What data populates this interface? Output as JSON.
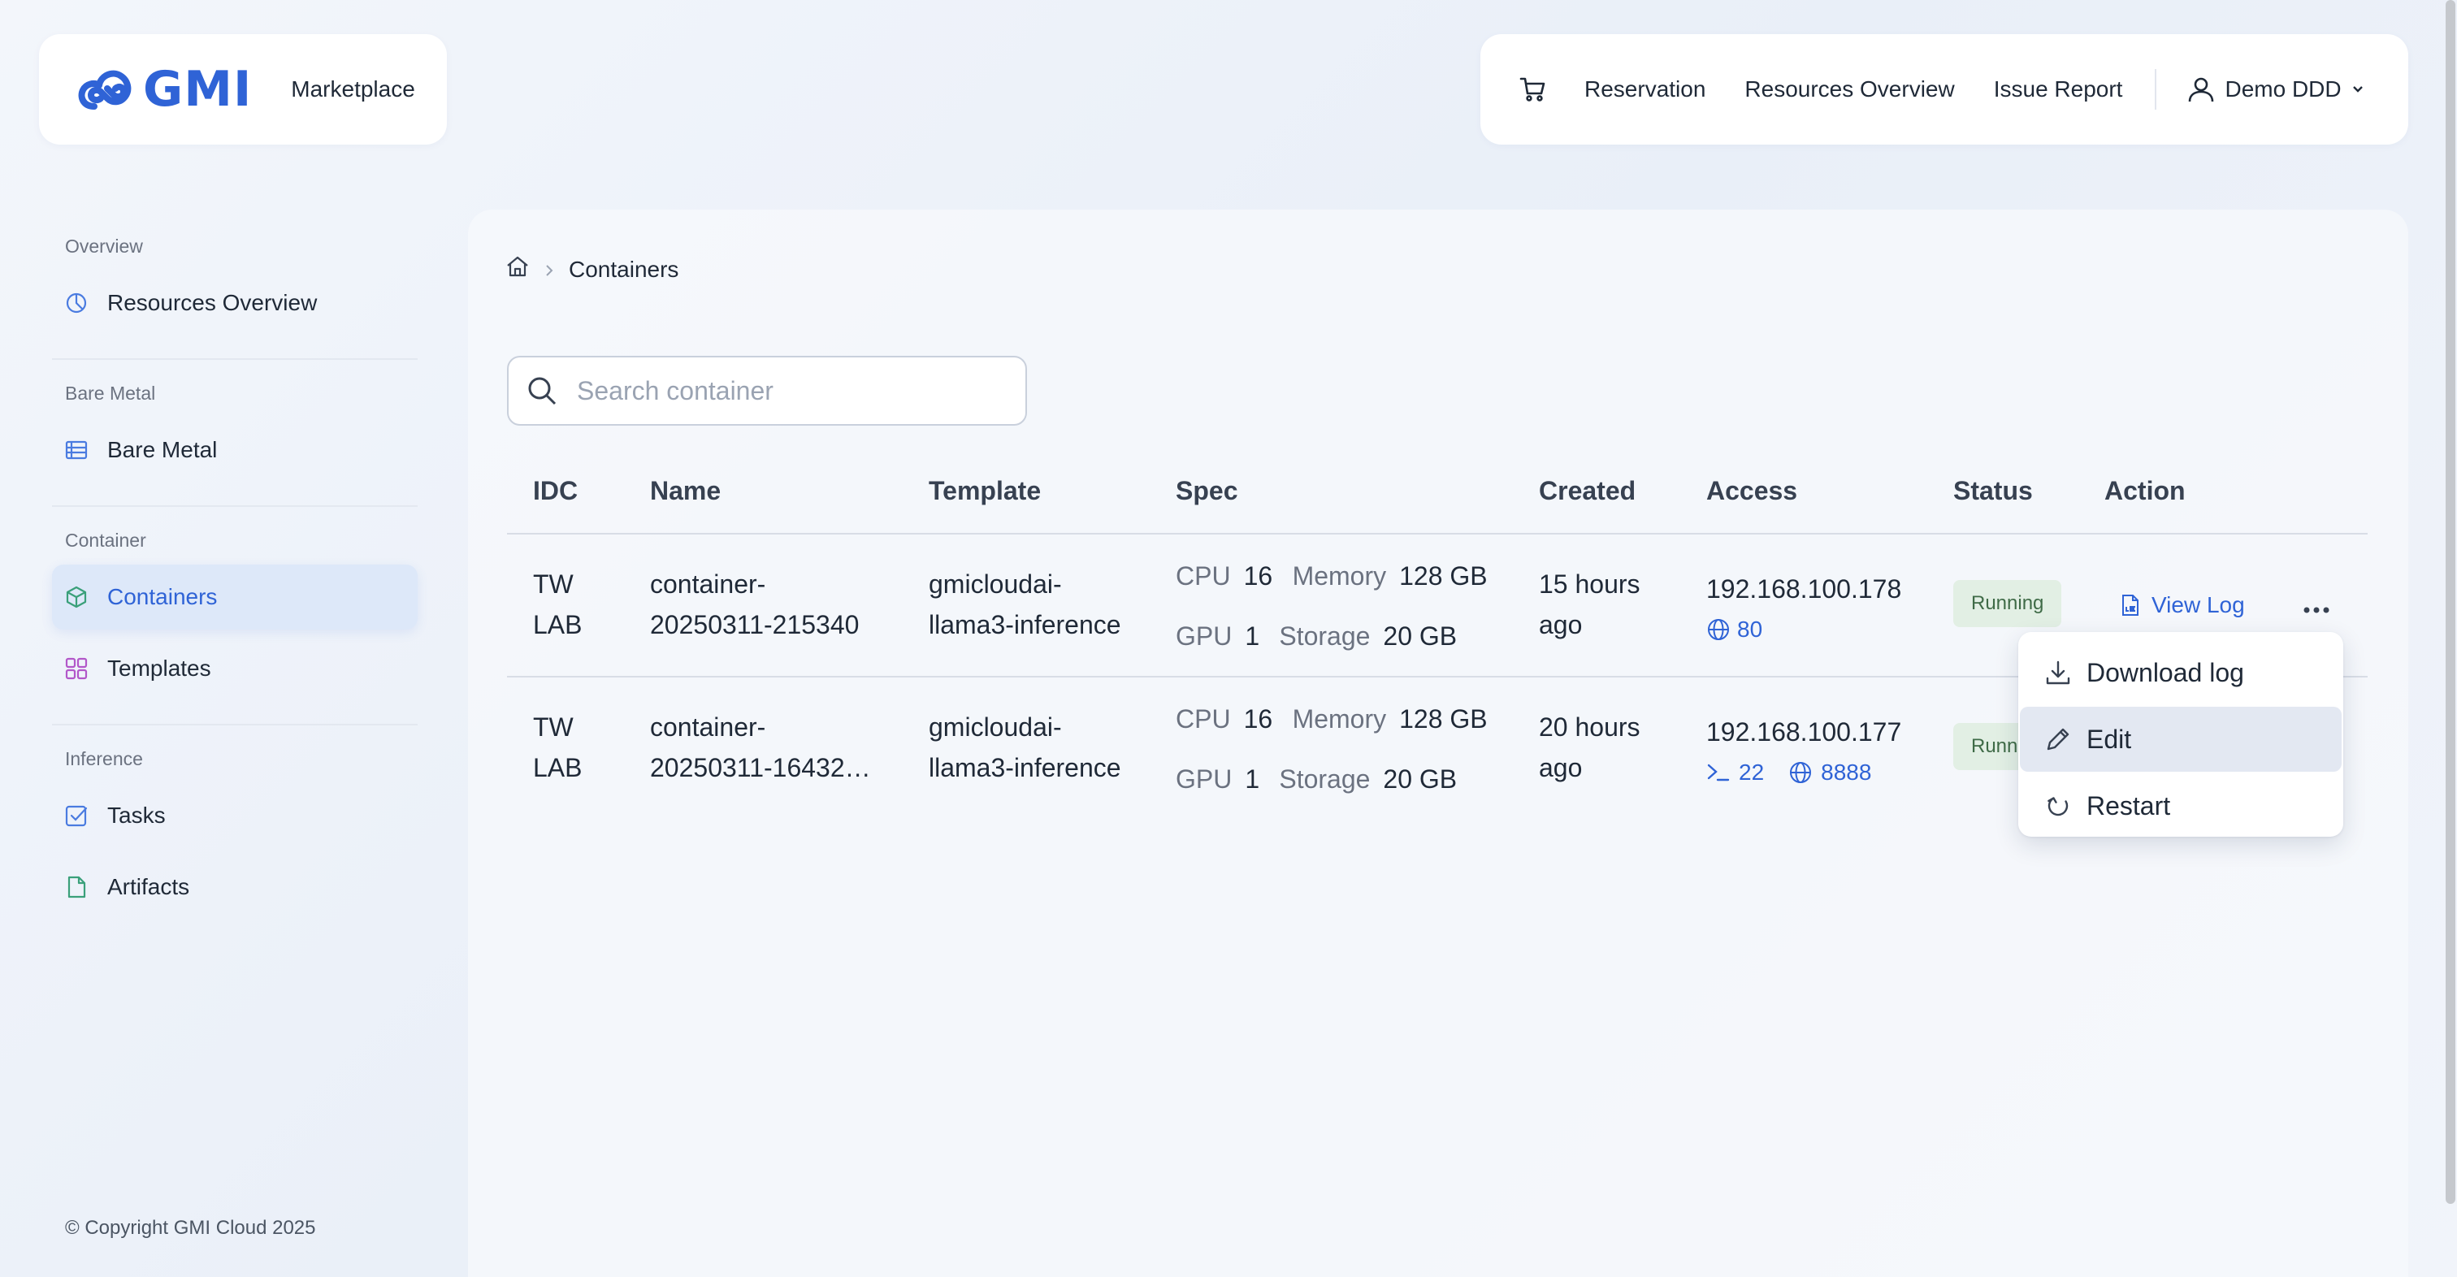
{
  "brand": {
    "logo_text": "GMI",
    "marketplace_label": "Marketplace"
  },
  "topnav": {
    "cart_icon": "cart-icon",
    "links": [
      "Reservation",
      "Resources Overview",
      "Issue Report"
    ],
    "user_name": "Demo DDD"
  },
  "sidebar": {
    "sections": [
      {
        "label": "Overview",
        "items": [
          {
            "label": "Resources Overview",
            "icon": "pie-chart-icon"
          }
        ]
      },
      {
        "label": "Bare Metal",
        "items": [
          {
            "label": "Bare Metal",
            "icon": "server-icon"
          }
        ]
      },
      {
        "label": "Container",
        "items": [
          {
            "label": "Containers",
            "icon": "cube-icon",
            "active": true
          },
          {
            "label": "Templates",
            "icon": "grid-icon"
          }
        ]
      },
      {
        "label": "Inference",
        "items": [
          {
            "label": "Tasks",
            "icon": "checkbox-icon"
          },
          {
            "label": "Artifacts",
            "icon": "file-icon"
          }
        ]
      }
    ],
    "copyright": "© Copyright GMI Cloud 2025"
  },
  "breadcrumb": {
    "current": "Containers"
  },
  "search": {
    "placeholder": "Search container",
    "value": ""
  },
  "table": {
    "headers": [
      "IDC",
      "Name",
      "Template",
      "Spec",
      "Created",
      "Access",
      "Status",
      "Action"
    ],
    "spec_labels": {
      "cpu": "CPU",
      "memory": "Memory",
      "gpu": "GPU",
      "storage": "Storage"
    },
    "rows": [
      {
        "idc_line1": "TW",
        "idc_line2": "LAB",
        "name_line1": "container-",
        "name_line2": "20250311-215340",
        "template_line1": "gmicloudai-",
        "template_line2": "llama3-inference",
        "cpu": "16",
        "memory": "128 GB",
        "gpu": "1",
        "storage": "20 GB",
        "created_line1": "15 hours",
        "created_line2": "ago",
        "ip": "192.168.100.178",
        "port_web": "80",
        "status": "Running",
        "view_log": "View Log"
      },
      {
        "idc_line1": "TW",
        "idc_line2": "LAB",
        "name_line1": "container-",
        "name_line2": "20250311-16432…",
        "template_line1": "gmicloudai-",
        "template_line2": "llama3-inference",
        "cpu": "16",
        "memory": "128 GB",
        "gpu": "1",
        "storage": "20 GB",
        "created_line1": "20 hours",
        "created_line2": "ago",
        "ip": "192.168.100.177",
        "port_ssh": "22",
        "port_web": "8888",
        "status": "Running"
      }
    ]
  },
  "action_menu": {
    "items": [
      "Download log",
      "Edit",
      "Restart"
    ],
    "highlighted": "Edit"
  },
  "colors": {
    "accent": "#2f63d6",
    "status_bg": "#e2efe4",
    "status_text": "#3f6b47",
    "active_bg": "#dde8f9"
  }
}
